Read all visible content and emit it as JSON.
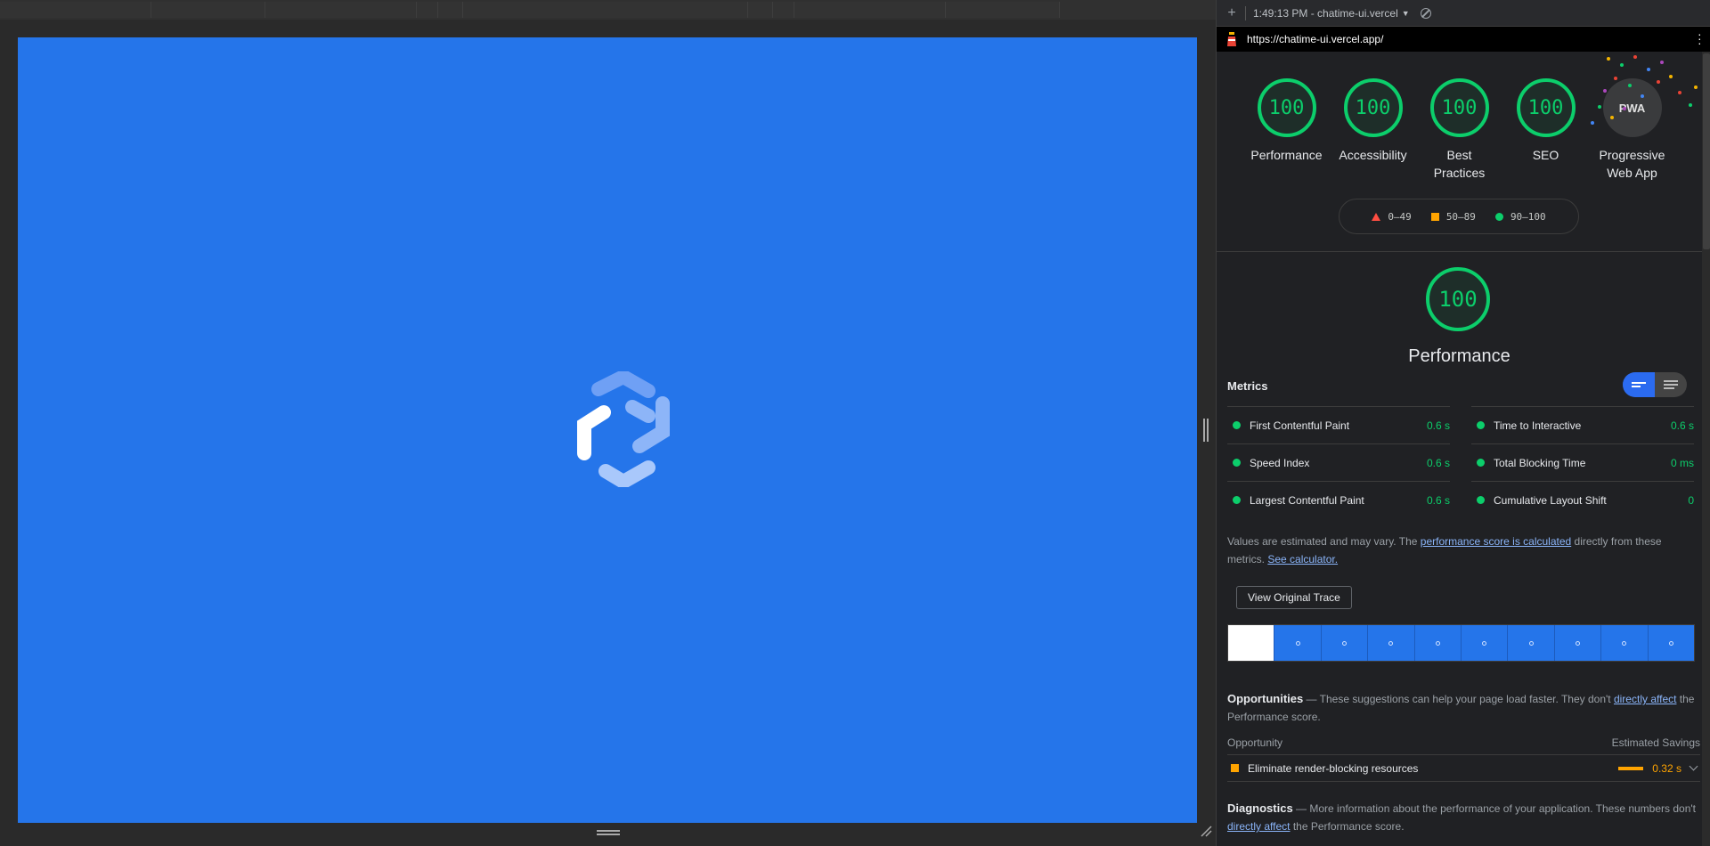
{
  "report": {
    "timestamp_label": "1:49:13 PM - chatime-ui.vercel",
    "url": "https://chatime-ui.vercel.app/"
  },
  "categories": [
    {
      "score": "100",
      "label": "Performance"
    },
    {
      "score": "100",
      "label": "Accessibility"
    },
    {
      "score": "100",
      "label": "Best Practices"
    },
    {
      "score": "100",
      "label": "SEO"
    },
    {
      "score": "PWA",
      "label": "Progressive Web App"
    }
  ],
  "legend": {
    "poor": "0–49",
    "average": "50–89",
    "good": "90–100"
  },
  "performance": {
    "score": "100",
    "title": "Performance",
    "metrics_title": "Metrics",
    "metrics": [
      {
        "label": "First Contentful Paint",
        "value": "0.6 s"
      },
      {
        "label": "Time to Interactive",
        "value": "0.6 s"
      },
      {
        "label": "Speed Index",
        "value": "0.6 s"
      },
      {
        "label": "Total Blocking Time",
        "value": "0 ms"
      },
      {
        "label": "Largest Contentful Paint",
        "value": "0.6 s"
      },
      {
        "label": "Cumulative Layout Shift",
        "value": "0"
      }
    ],
    "note_prefix": "Values are estimated and may vary. The ",
    "note_link": "performance score is calculated",
    "note_mid": " directly from these metrics. ",
    "note_calc": "See calculator.",
    "trace_button": "View Original Trace"
  },
  "opportunities": {
    "title": "Opportunities",
    "desc_prefix": " — These suggestions can help your page load faster. They don't ",
    "desc_link": "directly affect",
    "desc_suffix": " the Performance score.",
    "col_left": "Opportunity",
    "col_right": "Estimated Savings",
    "items": [
      {
        "label": "Eliminate render-blocking resources",
        "savings": "0.32 s"
      }
    ]
  },
  "diagnostics": {
    "title": "Diagnostics",
    "desc_prefix": " — More information about the performance of your application. These numbers don't ",
    "desc_link": "directly affect",
    "desc_suffix": " the Performance score."
  },
  "colors": {
    "good": "#0cce6b",
    "average": "#ffa400",
    "poor": "#ff4e42",
    "viewport_bg": "#2575ea"
  }
}
